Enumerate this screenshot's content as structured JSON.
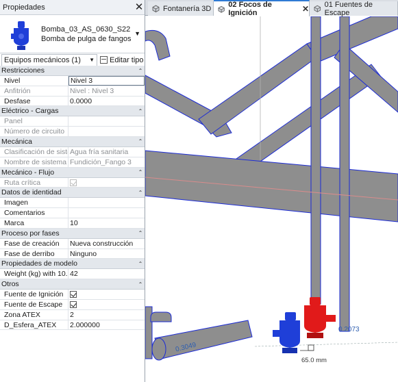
{
  "palette": {
    "title": "Propiedades",
    "close_glyph": "✕",
    "type_family": "Bomba_03_AS_0630_S22",
    "type_name": "Bomba de pulga de fangos",
    "filter": "Equipos mecánicos (1)",
    "edit_type": "Editar tipo",
    "groups": [
      {
        "label": "Restricciones",
        "rows": [
          {
            "name": "Nivel",
            "value": "Nivel 3",
            "editing": true
          },
          {
            "name": "Anfitrión",
            "value": "Nivel : Nivel 3",
            "disabled": true
          },
          {
            "name": "Desfase",
            "value": "0.0000"
          }
        ]
      },
      {
        "label": "Eléctrico - Cargas",
        "rows": [
          {
            "name": "Panel",
            "value": "",
            "disabled": true
          },
          {
            "name": "Número de circuito",
            "value": "",
            "disabled": true
          }
        ]
      },
      {
        "label": "Mecánica",
        "rows": [
          {
            "name": "Clasificación de siste...",
            "value": "Agua fría sanitaria",
            "disabled": true
          },
          {
            "name": "Nombre de sistema",
            "value": "Fundición_Fango 3",
            "disabled": true
          }
        ]
      },
      {
        "label": "Mecánico - Flujo",
        "rows": [
          {
            "name": "Ruta crítica",
            "checkbox": true,
            "checked": true,
            "disabled": true
          }
        ]
      },
      {
        "label": "Datos de identidad",
        "rows": [
          {
            "name": "Imagen",
            "value": ""
          },
          {
            "name": "Comentarios",
            "value": ""
          },
          {
            "name": "Marca",
            "value": "10"
          }
        ]
      },
      {
        "label": "Proceso por fases",
        "rows": [
          {
            "name": "Fase de creación",
            "value": "Nueva construcción"
          },
          {
            "name": "Fase de derribo",
            "value": "Ninguno"
          }
        ]
      },
      {
        "label": "Propiedades de modelo",
        "rows": [
          {
            "name": "Weight (kg) with 10...",
            "value": "42"
          }
        ]
      },
      {
        "label": "Otros",
        "rows": [
          {
            "name": "Fuente de Ignición",
            "checkbox": true,
            "checked": true
          },
          {
            "name": "Fuente de Escape",
            "checkbox": true,
            "checked": true
          },
          {
            "name": "Zona ATEX",
            "value": "2"
          },
          {
            "name": "D_Esfera_ATEX",
            "value": "2.000000"
          }
        ]
      }
    ]
  },
  "tabs": [
    {
      "label": "Fontanería 3D",
      "active": false
    },
    {
      "label": "02 Focos de Ignición",
      "active": true
    },
    {
      "label": "01 Fuentes de Escape",
      "active": false
    }
  ],
  "viewport": {
    "dimension": "65.0 mm",
    "pipe_size_left": "0.3049",
    "pipe_size_right": "0.2073",
    "colors": {
      "pipe": "#8e8e8e",
      "edge": "#1b2bd6",
      "pump_blue": "#1f3fd8",
      "pump_red": "#e11a1a"
    }
  }
}
